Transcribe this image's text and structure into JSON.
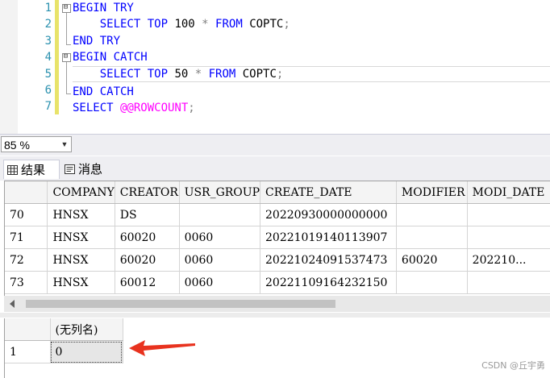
{
  "editor": {
    "line_numbers": [
      "1",
      "2",
      "3",
      "4",
      "5",
      "6",
      "7"
    ],
    "lines": [
      {
        "kw1": "BEGIN TRY",
        "rest": ""
      },
      {
        "indent": "    ",
        "kw1": "SELECT TOP",
        "num": " 100 ",
        "op": "*",
        "kw2": " FROM",
        "tbl": " COPTC",
        "end": ";"
      },
      {
        "kw1": "END TRY"
      },
      {
        "kw1": "BEGIN CATCH"
      },
      {
        "indent": "    ",
        "kw1": "SELECT TOP",
        "num": " 50 ",
        "op": "*",
        "kw2": " FROM",
        "tbl": " COPTC",
        "end": ";"
      },
      {
        "kw1": "END CATCH"
      },
      {
        "kw1": "SELECT",
        "sys": " @@ROWCOUNT",
        "end": ";"
      }
    ],
    "fold_minus": "⊟"
  },
  "zoom": {
    "value": "85 %"
  },
  "tabs": {
    "results_label": "结果",
    "messages_label": "消息"
  },
  "results1": {
    "columns": [
      "COMPANY",
      "CREATOR",
      "USR_GROUP",
      "CREATE_DATE",
      "MODIFIER",
      "MODI_DATE"
    ],
    "rows": [
      {
        "num": "70",
        "company": "HNSX",
        "creator": "DS",
        "usr_group": "",
        "create_date": "20220930000000000",
        "modifier": "",
        "modi_date": ""
      },
      {
        "num": "71",
        "company": "HNSX",
        "creator": "60020",
        "usr_group": "0060",
        "create_date": "20221019140113907",
        "modifier": "",
        "modi_date": ""
      },
      {
        "num": "72",
        "company": "HNSX",
        "creator": "60020",
        "usr_group": "0060",
        "create_date": "20221024091537473",
        "modifier": "60020",
        "modi_date": "202210..."
      },
      {
        "num": "73",
        "company": "HNSX",
        "creator": "60012",
        "usr_group": "0060",
        "create_date": "20221109164232150",
        "modifier": "",
        "modi_date": ""
      }
    ]
  },
  "results2": {
    "column": "(无列名)",
    "row_num": "1",
    "value": "0"
  },
  "colors": {
    "keyword": "#0000ff",
    "system": "#ff00ff",
    "line_number": "#2b91af",
    "arrow": "#e8321e"
  },
  "watermark": "CSDN @丘宇勇"
}
